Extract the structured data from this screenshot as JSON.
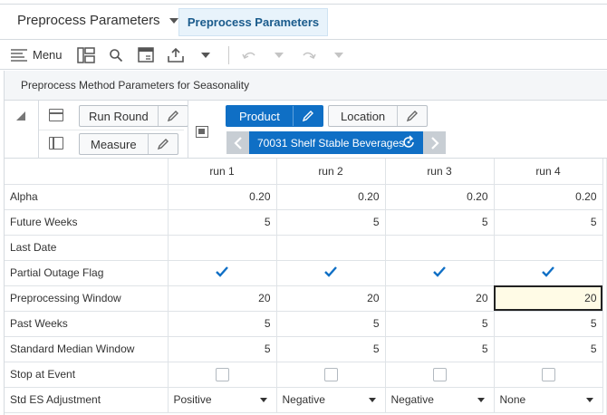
{
  "header": {
    "view_selector": "Preprocess Parameters",
    "active_tab": "Preprocess Parameters"
  },
  "toolbar": {
    "menu_label": "Menu",
    "icons": [
      "menu-icon",
      "pivot-icon",
      "search-icon",
      "calculator-icon",
      "export-icon",
      "chevron-down-icon",
      "undo-icon",
      "redo-icon"
    ]
  },
  "panel": {
    "title": "Preprocess Method Parameters for Seasonality"
  },
  "tiles": {
    "run_round": "Run Round",
    "measure": "Measure",
    "product": "Product",
    "location": "Location",
    "page_value": "70031 Shelf Stable Beverages"
  },
  "grid": {
    "columns": [
      "run 1",
      "run 2",
      "run 3",
      "run 4"
    ],
    "rows": [
      {
        "label": "Alpha",
        "type": "num",
        "values": [
          "0.20",
          "0.20",
          "0.20",
          "0.20"
        ]
      },
      {
        "label": "Future Weeks",
        "type": "num",
        "values": [
          "5",
          "5",
          "5",
          "5"
        ]
      },
      {
        "label": "Last Date",
        "type": "num",
        "values": [
          "",
          "",
          "",
          ""
        ]
      },
      {
        "label": "Partial Outage Flag",
        "type": "check",
        "values": [
          true,
          true,
          true,
          true
        ]
      },
      {
        "label": "Preprocessing Window",
        "type": "num",
        "values": [
          "20",
          "20",
          "20",
          "20"
        ]
      },
      {
        "label": "Past Weeks",
        "type": "num",
        "values": [
          "5",
          "5",
          "5",
          "5"
        ]
      },
      {
        "label": "Standard Median Window",
        "type": "num",
        "values": [
          "5",
          "5",
          "5",
          "5"
        ]
      },
      {
        "label": "Stop at Event",
        "type": "check",
        "values": [
          false,
          false,
          false,
          false
        ]
      },
      {
        "label": "Std ES Adjustment",
        "type": "select",
        "values": [
          "Positive",
          "Negative",
          "Negative",
          "None"
        ]
      }
    ]
  },
  "colors": {
    "accent": "#0f6fc5",
    "check": "#0f6fc5",
    "selected_cell_bg": "#fffbe6"
  }
}
